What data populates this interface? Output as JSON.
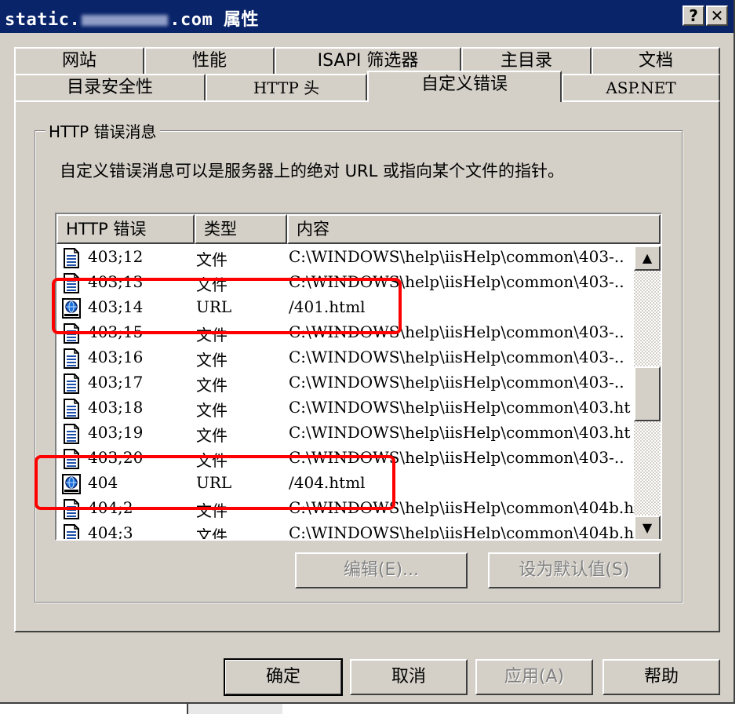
{
  "window": {
    "title_prefix": "static.",
    "title_suffix": ".com 属性",
    "help_button": "?",
    "close_button": "✕"
  },
  "tabs": {
    "row1": [
      "网站",
      "性能",
      "ISAPI 筛选器",
      "主目录",
      "文档"
    ],
    "row2": [
      "目录安全性",
      "HTTP 头",
      "自定义错误",
      "ASP.NET"
    ],
    "active": "自定义错误"
  },
  "group": {
    "legend": "HTTP 错误消息",
    "description": "自定义错误消息可以是服务器上的绝对 URL 或指向某个文件的指针。"
  },
  "list": {
    "columns": [
      "HTTP 错误",
      "类型",
      "内容"
    ],
    "rows": [
      {
        "code": "403;12",
        "type": "文件",
        "content": "C:\\WINDOWS\\help\\iisHelp\\common\\403-..",
        "icon": "file-icon"
      },
      {
        "code": "403;13",
        "type": "文件",
        "content": "C:\\WINDOWS\\help\\iisHelp\\common\\403-..",
        "icon": "file-icon"
      },
      {
        "code": "403;14",
        "type": "URL",
        "content": "/401.html",
        "icon": "url-globe-icon"
      },
      {
        "code": "403;15",
        "type": "文件",
        "content": "C:\\WINDOWS\\help\\iisHelp\\common\\403-..",
        "icon": "file-icon"
      },
      {
        "code": "403;16",
        "type": "文件",
        "content": "C:\\WINDOWS\\help\\iisHelp\\common\\403-..",
        "icon": "file-icon"
      },
      {
        "code": "403;17",
        "type": "文件",
        "content": "C:\\WINDOWS\\help\\iisHelp\\common\\403-..",
        "icon": "file-icon"
      },
      {
        "code": "403;18",
        "type": "文件",
        "content": "C:\\WINDOWS\\help\\iisHelp\\common\\403.ht",
        "icon": "file-icon"
      },
      {
        "code": "403;19",
        "type": "文件",
        "content": "C:\\WINDOWS\\help\\iisHelp\\common\\403.ht",
        "icon": "file-icon"
      },
      {
        "code": "403;20",
        "type": "文件",
        "content": "C:\\WINDOWS\\help\\iisHelp\\common\\403-..",
        "icon": "file-icon"
      },
      {
        "code": "404",
        "type": "URL",
        "content": "/404.html",
        "icon": "url-globe-icon"
      },
      {
        "code": "404;2",
        "type": "文件",
        "content": "C:\\WINDOWS\\help\\iisHelp\\common\\404b.h",
        "icon": "file-icon"
      },
      {
        "code": "404;3",
        "type": "文件",
        "content": "C:\\WINDOWS\\help\\iisHelp\\common\\404b.h",
        "icon": "file-icon"
      }
    ],
    "scroll_up": "▲",
    "scroll_down": "▼"
  },
  "actions": {
    "edit": "编辑(E)...",
    "set_default": "设为默认值(S)"
  },
  "footer": {
    "ok": "确定",
    "cancel": "取消",
    "apply": "应用(A)",
    "help": "帮助"
  },
  "colors": {
    "titlebar": "#0a246a",
    "face": "#d4d0c8",
    "highlight_box": "#ff0000"
  }
}
